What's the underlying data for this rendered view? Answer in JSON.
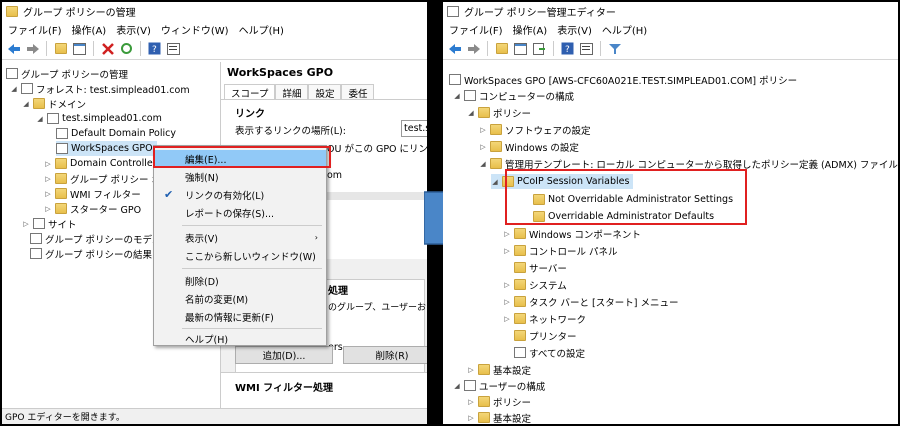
{
  "left": {
    "title": "グループ ポリシーの管理",
    "menu": [
      "ファイル(F)",
      "操作(A)",
      "表示(V)",
      "ウィンドウ(W)",
      "ヘルプ(H)"
    ],
    "tree": {
      "root": "グループ ポリシーの管理",
      "forest": "フォレスト: test.simplead01.com",
      "domains": "ドメイン",
      "domain": "test.simplead01.com",
      "ddp": "Default Domain Policy",
      "wsgpo": "WorkSpaces GPO",
      "dc": "Domain Controlle",
      "gpoobj": "グループ ポリシー オブ",
      "wmi": "WMI フィルター",
      "starter": "スターター GPO",
      "sites": "サイト",
      "modeling": "グループ ポリシーのモデル作成",
      "results": "グループ ポリシーの結果"
    },
    "right_panel": {
      "title": "WorkSpaces GPO",
      "tabs": [
        "スコープ",
        "詳細",
        "設定",
        "委任"
      ],
      "links_heading": "リンク",
      "link_location_label": "表示するリンクの場所(L):",
      "link_location_value": "test.simp",
      "ou_text": "OU がこの GPO にリンクされて",
      "om": "om",
      "proc": "処理",
      "group_text": "のグループ、ユーザーおよびコンピ",
      "ers": "ers",
      "add_button": "追加(D)...",
      "remove_button": "削除(R)",
      "wmi_heading": "WMI フィルター処理"
    },
    "context_menu": {
      "edit": "編集(E)...",
      "enforce": "強制(N)",
      "link_enabled": "リンクの有効化(L)",
      "save_report": "レポートの保存(S)...",
      "view": "表示(V)",
      "new_window": "ここから新しいウィンドウ(W)",
      "delete": "削除(D)",
      "rename": "名前の変更(M)",
      "refresh": "最新の情報に更新(F)",
      "help": "ヘルプ(H)"
    },
    "status": "GPO エディターを開きます。"
  },
  "right": {
    "title": "グループ ポリシー管理エディター",
    "menu": [
      "ファイル(F)",
      "操作(A)",
      "表示(V)",
      "ヘルプ(H)"
    ],
    "tree": {
      "root": "WorkSpaces GPO [AWS-CFC60A021E.TEST.SIMPLEAD01.COM] ポリシー",
      "computer": "コンピューターの構成",
      "policy": "ポリシー",
      "software": "ソフトウェアの設定",
      "windows": "Windows の設定",
      "admx": "管理用テンプレート: ローカル コンピューターから取得したポリシー定義 (ADMX) ファイルです。",
      "pcoip": "PCoIP Session Variables",
      "not_override": "Not Overridable Administrator Settings",
      "override": "Overridable Administrator Defaults",
      "wincomp": "Windows コンポーネント",
      "control": "コントロール パネル",
      "server": "サーバー",
      "system": "システム",
      "taskbar": "タスク バーと [スタート] メニュー",
      "network": "ネットワーク",
      "printer": "プリンター",
      "all": "すべての設定",
      "basic1": "基本設定",
      "user": "ユーザーの構成",
      "policy2": "ポリシー",
      "basic2": "基本設定"
    }
  },
  "colors": {
    "highlight": "#cce4f7",
    "red": "#e02020",
    "arrow": "#3f7fc4"
  }
}
